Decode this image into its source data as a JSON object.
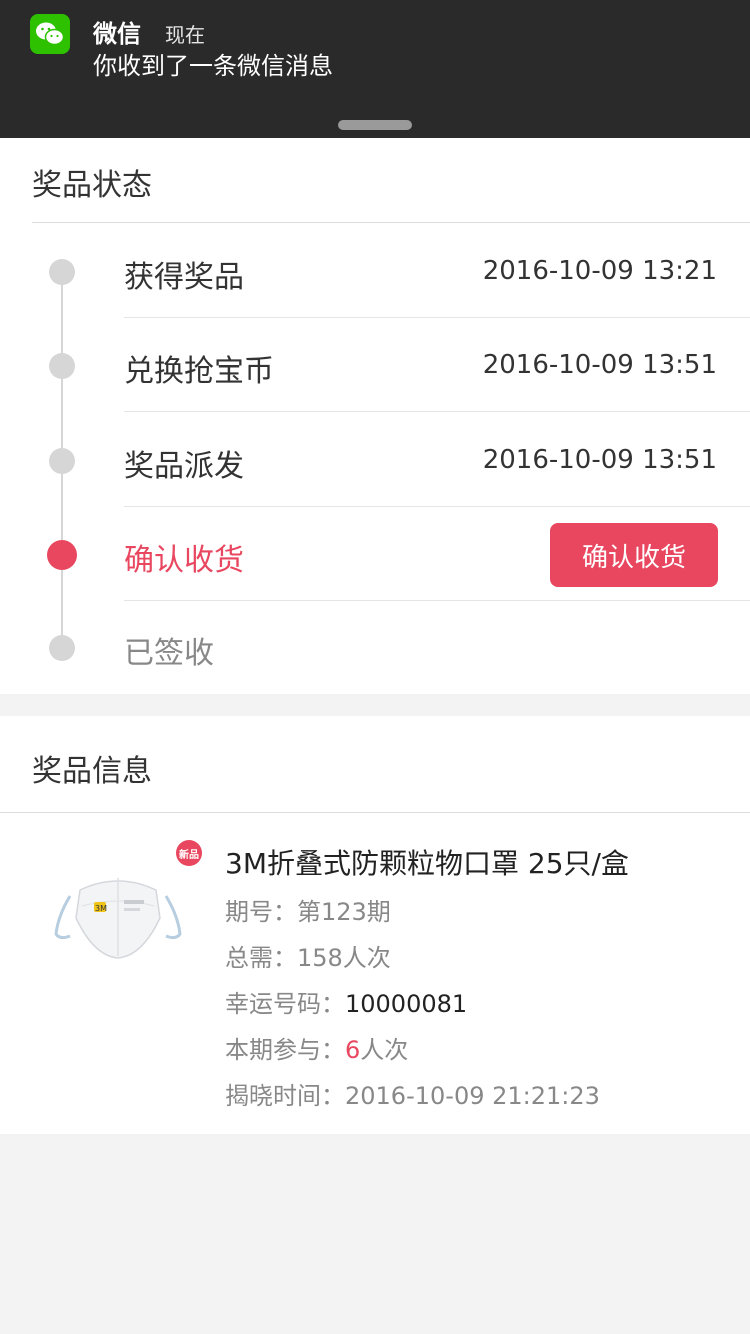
{
  "notification": {
    "app_name": "微信",
    "time": "现在",
    "message": "你收到了一条微信消息",
    "icon": "wechat-icon",
    "accent": "#2dc100"
  },
  "status_section": {
    "title": "奖品状态",
    "steps": [
      {
        "label": "获得奖品",
        "time": "2016-10-09 13:21",
        "state": "done"
      },
      {
        "label": "兑换抢宝币",
        "time": "2016-10-09 13:51",
        "state": "done"
      },
      {
        "label": "奖品派发",
        "time": "2016-10-09 13:51",
        "state": "done"
      },
      {
        "label": "确认收货",
        "button": "确认收货",
        "state": "active"
      },
      {
        "label": "已签收",
        "state": "pending"
      }
    ],
    "active_color": "#e8475f"
  },
  "info_section": {
    "title": "奖品信息",
    "badge": "新品",
    "product_name": "3M折叠式防颗粒物口罩 25只/盒",
    "rows": {
      "period_label": "期号：",
      "period_value": "第123期",
      "total_label": "总需：",
      "total_value": "158人次",
      "lucky_label": "幸运号码：",
      "lucky_value": "10000081",
      "joined_label": "本期参与：",
      "joined_count": "6",
      "joined_unit": "人次",
      "reveal_label": "揭晓时间：",
      "reveal_value": "2016-10-09 21:21:23"
    }
  }
}
